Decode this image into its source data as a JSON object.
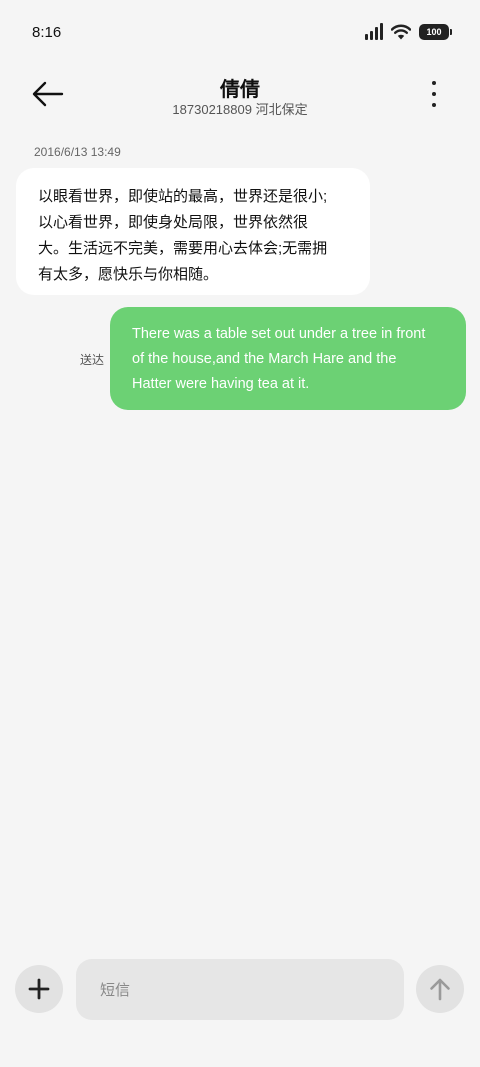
{
  "status_bar": {
    "time": "8:16",
    "battery": "100",
    "icons": [
      "signal-icon",
      "wifi-icon",
      "battery-icon"
    ]
  },
  "header": {
    "contact_name": "倩倩",
    "contact_detail": "18730218809 河北保定",
    "back_icon": "arrow-left-icon",
    "more_icon": "more-vertical-icon"
  },
  "conversation": {
    "timestamp": "2016/6/13 13:49",
    "received": {
      "lines": [
        "以眼看世界，即使站的最高，世界还是很小;",
        "以心看世界，即使身处局限，世界依然很",
        "大。生活远不完美，需要用心去体会;无需拥",
        "有太多，愿快乐与你相随。"
      ]
    },
    "sent": {
      "status": "送达",
      "lines": [
        "There was a table set out under a tree in front",
        "of the house,and the March Hare and the",
        "Hatter were having tea at it."
      ]
    }
  },
  "composer": {
    "placeholder": "短信",
    "add_icon": "plus-icon",
    "send_icon": "arrow-up-icon"
  },
  "colors": {
    "background": "#f5f5f5",
    "received_bubble": "#ffffff",
    "sent_bubble": "#6cd174",
    "sent_text": "#ffffff"
  }
}
